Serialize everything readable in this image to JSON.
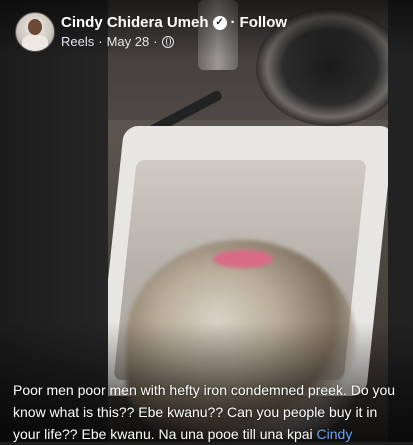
{
  "post": {
    "author_name": "Cindy Chidera Umeh",
    "separator": "·",
    "follow_label": "Follow",
    "source": "Reels",
    "date": "May 28",
    "meta_separator": "·",
    "audience_icon": "globe-icon",
    "verified_icon": "verified-badge-icon"
  },
  "caption": {
    "text": "Poor men poor men with hefty iron condemned preek. Do you know what is this?? Ebe kwanu?? Can you people buy it in your life?? Ebe kwanu. Na una pooe till una kpai ",
    "mention": "Cindy"
  },
  "colors": {
    "background": "#1f1f1f",
    "text": "#ffffff",
    "mention": "#66a8ff"
  }
}
